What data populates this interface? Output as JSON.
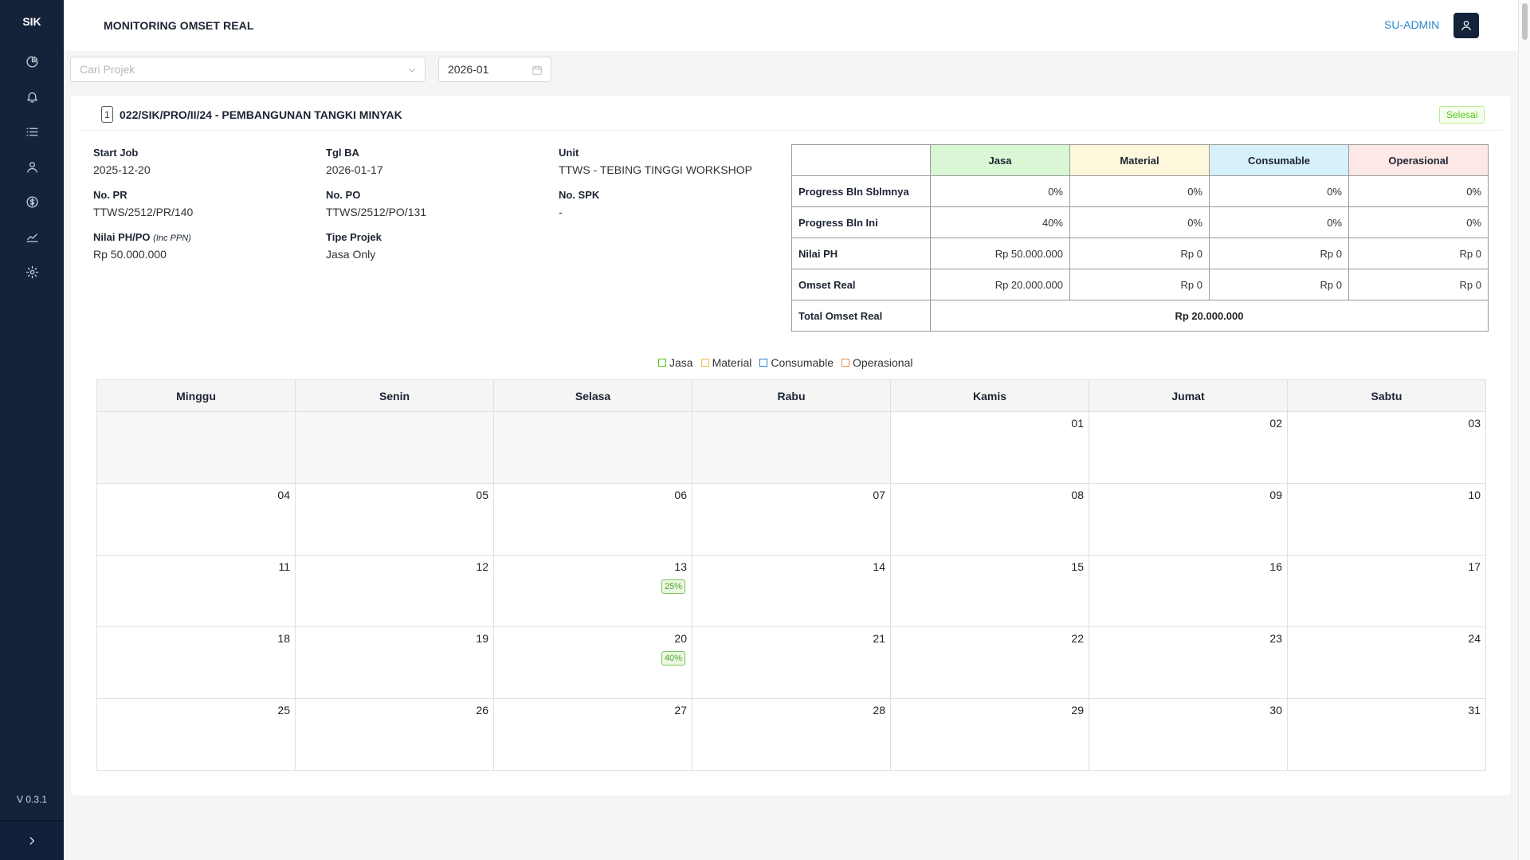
{
  "app": {
    "logo": "SIK",
    "version": "V 0.3.1"
  },
  "sidebar": {
    "items": [
      {
        "icon": "pie-chart-icon"
      },
      {
        "icon": "bell-icon"
      },
      {
        "icon": "list-icon"
      },
      {
        "icon": "user-icon"
      },
      {
        "icon": "dollar-icon"
      },
      {
        "icon": "line-chart-icon"
      },
      {
        "icon": "gear-icon"
      }
    ]
  },
  "header": {
    "title": "MONITORING OMSET REAL",
    "user": "SU-ADMIN"
  },
  "filters": {
    "project_placeholder": "Cari Projek",
    "month_value": "2026-01"
  },
  "project": {
    "index": "1",
    "title": "022/SIK/PRO/II/24 - PEMBANGUNAN TANGKI MINYAK",
    "status": "Selesai",
    "fields": {
      "start_job_label": "Start Job",
      "start_job": "2025-12-20",
      "tgl_ba_label": "Tgl BA",
      "tgl_ba": "2026-01-17",
      "unit_label": "Unit",
      "unit": "TTWS - TEBING TINGGI WORKSHOP",
      "no_pr_label": "No. PR",
      "no_pr": "TTWS/2512/PR/140",
      "no_po_label": "No. PO",
      "no_po": "TTWS/2512/PO/131",
      "no_spk_label": "No. SPK",
      "no_spk": "-",
      "nilai_label": "Nilai PH/PO",
      "nilai_note": "(Inc PPN)",
      "nilai": "Rp 50.000.000",
      "tipe_label": "Tipe Projek",
      "tipe": "Jasa Only"
    }
  },
  "summary": {
    "columns": [
      "Jasa",
      "Material",
      "Consumable",
      "Operasional"
    ],
    "column_colors": [
      "#d9f7d4",
      "#fdf8dc",
      "#d6f1fa",
      "#fde8e6"
    ],
    "rows": [
      {
        "label": "Progress Bln Sblmnya",
        "values": [
          "0%",
          "0%",
          "0%",
          "0%"
        ]
      },
      {
        "label": "Progress Bln Ini",
        "values": [
          "40%",
          "0%",
          "0%",
          "0%"
        ]
      },
      {
        "label": "Nilai PH",
        "values": [
          "Rp 50.000.000",
          "Rp 0",
          "Rp 0",
          "Rp 0"
        ]
      },
      {
        "label": "Omset Real",
        "values": [
          "Rp 20.000.000",
          "Rp 0",
          "Rp 0",
          "Rp 0"
        ]
      }
    ],
    "total_label": "Total Omset Real",
    "total_value": "Rp 20.000.000"
  },
  "legend": [
    {
      "label": "Jasa",
      "color": "#52c41a"
    },
    {
      "label": "Material",
      "color": "#f5b942"
    },
    {
      "label": "Consumable",
      "color": "#2a7fc9"
    },
    {
      "label": "Operasional",
      "color": "#f08a3c"
    }
  ],
  "calendar": {
    "days": [
      "Minggu",
      "Senin",
      "Selasa",
      "Rabu",
      "Kamis",
      "Jumat",
      "Sabtu"
    ],
    "weeks": [
      [
        "",
        "",
        "",
        "",
        "01",
        "02",
        "03"
      ],
      [
        "04",
        "05",
        "06",
        "07",
        "08",
        "09",
        "10"
      ],
      [
        "11",
        "12",
        "13",
        "14",
        "15",
        "16",
        "17"
      ],
      [
        "18",
        "19",
        "20",
        "21",
        "22",
        "23",
        "24"
      ],
      [
        "25",
        "26",
        "27",
        "28",
        "29",
        "30",
        "31"
      ]
    ],
    "badges": {
      "13": "25%",
      "20": "40%"
    }
  }
}
